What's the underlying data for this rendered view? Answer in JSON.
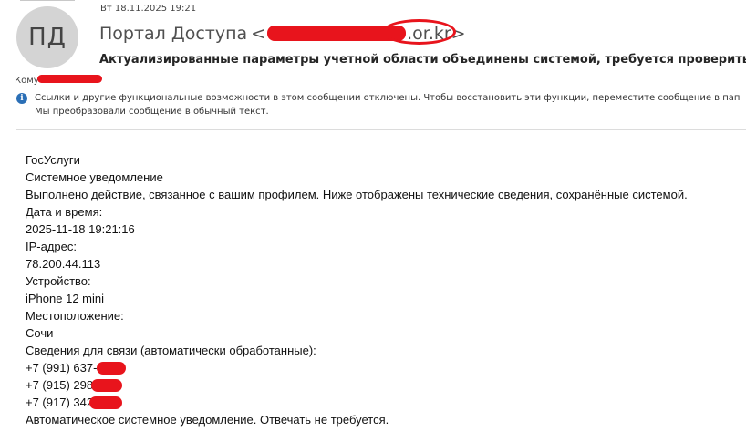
{
  "header": {
    "avatar_initials": "ПД",
    "date": "Вт 18.11.2025 19:21",
    "sender_name": "Портал Доступа",
    "sender_open": "<",
    "sender_domain_tail": ".or.kr>",
    "subject": "Актуализированные параметры учетной области объединены системой, требуется проверить корр",
    "to_label": "Кому"
  },
  "notice": {
    "icon": "info-icon",
    "line1": "Ссылки и другие функциональные возможности в этом сообщении отключены. Чтобы восстановить эти функции, переместите сообщение в пап",
    "line2": "Мы преобразовали сообщение в обычный текст."
  },
  "body": {
    "service": "ГосУслуги",
    "type": "Системное уведомление",
    "intro": "Выполнено действие, связанное с вашим профилем. Ниже отображены технические сведения, сохранённые системой.",
    "datetime_label": "Дата и время:",
    "datetime_value": "2025-11-18 19:21:16",
    "ip_label": "IP-адрес:",
    "ip_value": "78.200.44.113",
    "device_label": "Устройство:",
    "device_value": "iPhone 12 mini",
    "location_label": "Местоположение:",
    "location_value": "Сочи",
    "contacts_label": "Сведения для связи (автоматически обработанные):",
    "phones": [
      "+7 (991) 637-",
      "+7 (915) 298-",
      "+7 (917) 342"
    ],
    "footer": "Автоматическое системное уведомление. Отвечать не требуется."
  },
  "colors": {
    "redaction": "#e8141c",
    "info_icon": "#2b6fb6",
    "avatar_bg": "#d4d4d4"
  }
}
